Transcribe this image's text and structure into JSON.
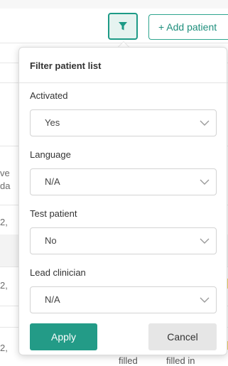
{
  "header": {
    "filter_icon": "funnel-icon",
    "add_patient_label": "+ Add patient"
  },
  "background": {
    "fragments": [
      "ve",
      "da",
      "2,",
      "2,",
      "2,"
    ],
    "bottom_cells": [
      "filled",
      "filled in"
    ]
  },
  "filter_panel": {
    "title": "Filter patient list",
    "fields": [
      {
        "label": "Activated",
        "value": "Yes"
      },
      {
        "label": "Language",
        "value": "N/A"
      },
      {
        "label": "Test patient",
        "value": "No"
      },
      {
        "label": "Lead clinician",
        "value": "N/A"
      }
    ],
    "apply_label": "Apply",
    "cancel_label": "Cancel"
  },
  "colors": {
    "accent": "#239b87",
    "accent_light": "#e6f3f0",
    "cancel_bg": "#e6e6e6"
  }
}
